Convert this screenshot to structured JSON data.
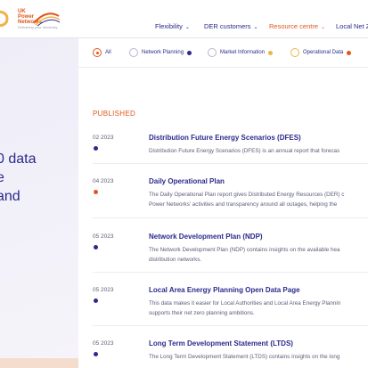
{
  "brand": {
    "line1": "UK",
    "line2": "Power",
    "line3": "Networks",
    "tagline": "Delivering your electricity"
  },
  "nav": [
    {
      "label": "Flexibility",
      "active": false
    },
    {
      "label": "DER customers",
      "active": false
    },
    {
      "label": "Resource centre",
      "active": true
    },
    {
      "label": "Local Net Z",
      "active": false
    }
  ],
  "hero": {
    "text": "0 data\ne\nand"
  },
  "filters": [
    {
      "label": "All",
      "selected": true
    },
    {
      "label": "Network Planning",
      "dot_color": "#2a2a8c"
    },
    {
      "label": "Market Information",
      "dot_color": "#f2b24a"
    },
    {
      "label": "Operational Data",
      "dot_color": "#e2571a"
    }
  ],
  "section_label": "PUBLISHED",
  "items": [
    {
      "date": "02 2023",
      "dot_color": "#2a2a8c",
      "title": "Distribution Future Energy Scenarios (DFES)",
      "desc": "Distribution Future Energy Scenarios (DFES) is an annual report that forecas"
    },
    {
      "date": "04 2023",
      "dot_color": "#e2571a",
      "title": "Daily Operational Plan",
      "desc": "The Daily Operational Plan report gives Distributed Energy Resources (DER) c\nPower Networks' activities and transparency around all outages, helping the"
    },
    {
      "date": "05 2023",
      "dot_color": "#2a2a8c",
      "title": "Network Development Plan (NDP)",
      "desc": "The Network Development Plan (NDP) contains insights on the available hea\ndistribution networks."
    },
    {
      "date": "05 2023",
      "dot_color": "#2a2a8c",
      "title": "Local Area Energy Planning Open Data Page",
      "desc": "This data makes it easier for Local Authorities and Local Area Energy Plannin\nsupports their net zero planning ambitions."
    },
    {
      "date": "05 2023",
      "dot_color": "#2a2a8c",
      "title": "Long Term Development Statement (LTDS)",
      "desc": "The Long Term Development Statement (LTDS) contains insights on the long"
    }
  ]
}
